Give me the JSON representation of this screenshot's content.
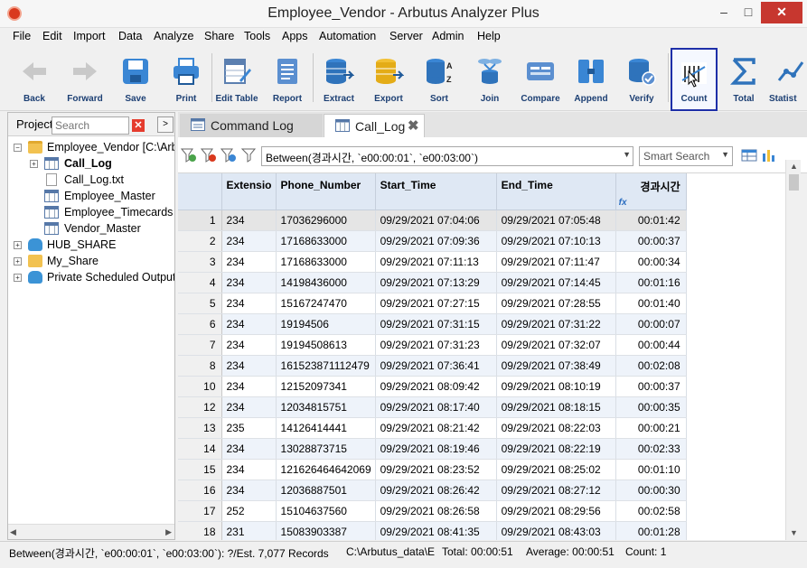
{
  "window": {
    "title": "Employee_Vendor - Arbutus Analyzer Plus",
    "min": "–",
    "max": "□",
    "close": "✕"
  },
  "menu": [
    "File",
    "Edit",
    "Import",
    "Data",
    "Analyze",
    "Share",
    "Tools",
    "Apps",
    "Automation",
    "Server",
    "Admin",
    "Help"
  ],
  "toolbar": {
    "back": "Back",
    "forward": "Forward",
    "save": "Save",
    "print": "Print",
    "edit_table": "Edit Table",
    "report": "Report",
    "extract": "Extract",
    "export": "Export",
    "sort": "Sort",
    "join": "Join",
    "compare": "Compare",
    "append": "Append",
    "verify": "Verify",
    "count": "Count",
    "total": "Total",
    "statistics": "Statist"
  },
  "project": {
    "title": "Project",
    "search_placeholder": "Search",
    "tree": [
      {
        "label": "Employee_Vendor [C:\\Arbu",
        "icon": "folder-icon"
      },
      {
        "label": "Call_Log",
        "icon": "table-icon",
        "bold": true
      },
      {
        "label": "Call_Log.txt",
        "icon": "file-icon"
      },
      {
        "label": "Employee_Master",
        "icon": "table-icon"
      },
      {
        "label": "Employee_Timecards",
        "icon": "table-icon"
      },
      {
        "label": "Vendor_Master",
        "icon": "table-icon"
      },
      {
        "label": "HUB_SHARE",
        "icon": "cloud-icon"
      },
      {
        "label": "My_Share",
        "icon": "user-folder-icon"
      },
      {
        "label": "Private Scheduled Output:",
        "icon": "cloud-icon"
      }
    ]
  },
  "tabs": [
    {
      "label": "Command Log"
    },
    {
      "label": "Call_Log",
      "close": "✖"
    }
  ],
  "filter": {
    "expression": "Between(경과시간, `e00:00:01`, `e00:03:00`)",
    "smart_search": "Smart Search"
  },
  "grid": {
    "columns": [
      "Extensio",
      "Phone_Number",
      "Start_Time",
      "End_Time",
      "경과시간"
    ],
    "fx": "fx",
    "rows": [
      [
        "1",
        "234",
        "17036296000",
        "09/29/2021 07:04:06",
        "09/29/2021 07:05:48",
        "00:01:42"
      ],
      [
        "2",
        "234",
        "17168633000",
        "09/29/2021 07:09:36",
        "09/29/2021 07:10:13",
        "00:00:37"
      ],
      [
        "3",
        "234",
        "17168633000",
        "09/29/2021 07:11:13",
        "09/29/2021 07:11:47",
        "00:00:34"
      ],
      [
        "4",
        "234",
        "14198436000",
        "09/29/2021 07:13:29",
        "09/29/2021 07:14:45",
        "00:01:16"
      ],
      [
        "5",
        "234",
        "15167247470",
        "09/29/2021 07:27:15",
        "09/29/2021 07:28:55",
        "00:01:40"
      ],
      [
        "6",
        "234",
        "19194506",
        "09/29/2021 07:31:15",
        "09/29/2021 07:31:22",
        "00:00:07"
      ],
      [
        "7",
        "234",
        "19194508613",
        "09/29/2021 07:31:23",
        "09/29/2021 07:32:07",
        "00:00:44"
      ],
      [
        "8",
        "234",
        "161523871112479",
        "09/29/2021 07:36:41",
        "09/29/2021 07:38:49",
        "00:02:08"
      ],
      [
        "10",
        "234",
        "12152097341",
        "09/29/2021 08:09:42",
        "09/29/2021 08:10:19",
        "00:00:37"
      ],
      [
        "12",
        "234",
        "12034815751",
        "09/29/2021 08:17:40",
        "09/29/2021 08:18:15",
        "00:00:35"
      ],
      [
        "13",
        "235",
        "14126414441",
        "09/29/2021 08:21:42",
        "09/29/2021 08:22:03",
        "00:00:21"
      ],
      [
        "14",
        "234",
        "13028873715",
        "09/29/2021 08:19:46",
        "09/29/2021 08:22:19",
        "00:02:33"
      ],
      [
        "15",
        "234",
        "121626464642069",
        "09/29/2021 08:23:52",
        "09/29/2021 08:25:02",
        "00:01:10"
      ],
      [
        "16",
        "234",
        "12036887501",
        "09/29/2021 08:26:42",
        "09/29/2021 08:27:12",
        "00:00:30"
      ],
      [
        "17",
        "252",
        "15104637560",
        "09/29/2021 08:26:58",
        "09/29/2021 08:29:56",
        "00:02:58"
      ],
      [
        "18",
        "231",
        "15083903387",
        "09/29/2021 08:41:35",
        "09/29/2021 08:43:03",
        "00:01:28"
      ]
    ]
  },
  "status": {
    "filter": "Between(경과시간, `e00:00:01`, `e00:03:00`): ?/Est. 7,077 Records",
    "path": "C:\\Arbutus_data\\E",
    "total": "Total: 00:00:51",
    "average": "Average: 00:00:51",
    "count": "Count: 1"
  },
  "colors": {
    "accent": "#1e2fa8",
    "header_bg": "#dfe8f4",
    "alt_row": "#eef3fa",
    "close_red": "#c7372f"
  }
}
